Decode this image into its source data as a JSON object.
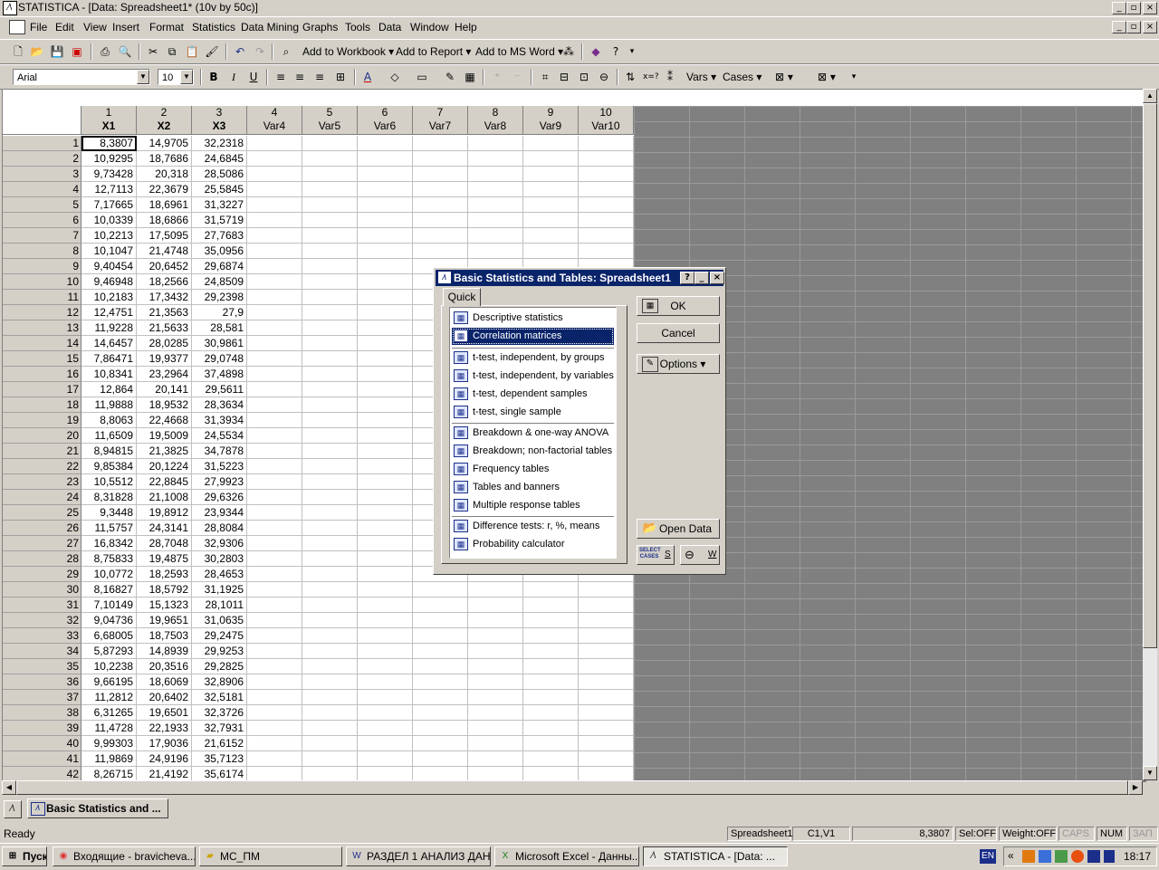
{
  "window": {
    "title": "STATISTICA - [Data: Spreadsheet1* (10v by 50c)]",
    "buttons": [
      "_",
      "▫",
      "×"
    ]
  },
  "menu": [
    "File",
    "Edit",
    "View",
    "Insert",
    "Format",
    "Statistics",
    "Data Mining",
    "Graphs",
    "Tools",
    "Data",
    "Window",
    "Help"
  ],
  "toolbar1": {
    "add_workbook": "Add to Workbook",
    "add_report": "Add to Report",
    "add_msword": "Add to MS Word"
  },
  "toolbar2": {
    "font": "Arial",
    "size": "10",
    "bold": "B",
    "italic": "I",
    "underline": "U",
    "vars": "Vars",
    "cases": "Cases"
  },
  "columns": [
    {
      "num": "1",
      "name": "X1"
    },
    {
      "num": "2",
      "name": "X2"
    },
    {
      "num": "3",
      "name": "X3"
    },
    {
      "num": "4",
      "name": "Var4"
    },
    {
      "num": "5",
      "name": "Var5"
    },
    {
      "num": "6",
      "name": "Var6"
    },
    {
      "num": "7",
      "name": "Var7"
    },
    {
      "num": "8",
      "name": "Var8"
    },
    {
      "num": "9",
      "name": "Var9"
    },
    {
      "num": "10",
      "name": "Var10"
    }
  ],
  "rows": [
    [
      "8,3807",
      "14,9705",
      "32,2318"
    ],
    [
      "10,9295",
      "18,7686",
      "24,6845"
    ],
    [
      "9,73428",
      "20,318",
      "28,5086"
    ],
    [
      "12,7113",
      "22,3679",
      "25,5845"
    ],
    [
      "7,17665",
      "18,6961",
      "31,3227"
    ],
    [
      "10,0339",
      "18,6866",
      "31,5719"
    ],
    [
      "10,2213",
      "17,5095",
      "27,7683"
    ],
    [
      "10,1047",
      "21,4748",
      "35,0956"
    ],
    [
      "9,40454",
      "20,6452",
      "29,6874"
    ],
    [
      "9,46948",
      "18,2566",
      "24,8509"
    ],
    [
      "10,2183",
      "17,3432",
      "29,2398"
    ],
    [
      "12,4751",
      "21,3563",
      "27,9"
    ],
    [
      "11,9228",
      "21,5633",
      "28,581"
    ],
    [
      "14,6457",
      "28,0285",
      "30,9861"
    ],
    [
      "7,86471",
      "19,9377",
      "29,0748"
    ],
    [
      "10,8341",
      "23,2964",
      "37,4898"
    ],
    [
      "12,864",
      "20,141",
      "29,5611"
    ],
    [
      "11,9888",
      "18,9532",
      "28,3634"
    ],
    [
      "8,8063",
      "22,4668",
      "31,3934"
    ],
    [
      "11,6509",
      "19,5009",
      "24,5534"
    ],
    [
      "8,94815",
      "21,3825",
      "34,7878"
    ],
    [
      "9,85384",
      "20,1224",
      "31,5223"
    ],
    [
      "10,5512",
      "22,8845",
      "27,9923"
    ],
    [
      "8,31828",
      "21,1008",
      "29,6326"
    ],
    [
      "9,3448",
      "19,8912",
      "23,9344"
    ],
    [
      "11,5757",
      "24,3141",
      "28,8084"
    ],
    [
      "16,8342",
      "28,7048",
      "32,9306"
    ],
    [
      "8,75833",
      "19,4875",
      "30,2803"
    ],
    [
      "10,0772",
      "18,2593",
      "28,4653"
    ],
    [
      "8,16827",
      "18,5792",
      "31,1925"
    ],
    [
      "7,10149",
      "15,1323",
      "28,1011"
    ],
    [
      "9,04736",
      "19,9651",
      "31,0635"
    ],
    [
      "6,68005",
      "18,7503",
      "29,2475"
    ],
    [
      "5,87293",
      "14,8939",
      "29,9253"
    ],
    [
      "10,2238",
      "20,3516",
      "29,2825"
    ],
    [
      "9,66195",
      "18,6069",
      "32,8906"
    ],
    [
      "11,2812",
      "20,6402",
      "32,5181"
    ],
    [
      "6,31265",
      "19,6501",
      "32,3726"
    ],
    [
      "11,4728",
      "22,1933",
      "32,7931"
    ],
    [
      "9,99303",
      "17,9036",
      "21,6152"
    ],
    [
      "11,9869",
      "24,9196",
      "35,7123"
    ],
    [
      "8,26715",
      "21,4192",
      "35,6174"
    ]
  ],
  "dialog": {
    "title": "Basic Statistics and Tables: Spreadsheet1",
    "tab": "Quick",
    "items": [
      {
        "label": "Descriptive statistics",
        "icon": "descriptive-icon"
      },
      {
        "label": "Correlation matrices",
        "icon": "correlation-icon",
        "selected": true
      },
      {
        "label": "t-test, independent, by groups",
        "icon": "ttest-groups-icon"
      },
      {
        "label": "t-test, independent, by variables",
        "icon": "ttest-vars-icon"
      },
      {
        "label": "t-test, dependent samples",
        "icon": "ttest-dependent-icon"
      },
      {
        "label": "t-test, single sample",
        "icon": "ttest-single-icon"
      },
      {
        "label": "Breakdown & one-way ANOVA",
        "icon": "breakdown-icon"
      },
      {
        "label": "Breakdown; non-factorial tables",
        "icon": "breakdown-nonfactorial-icon"
      },
      {
        "label": "Frequency tables",
        "icon": "frequency-icon"
      },
      {
        "label": "Tables and banners",
        "icon": "tables-icon"
      },
      {
        "label": "Multiple response tables",
        "icon": "multiresponse-icon"
      },
      {
        "label": "Difference tests: r, %, means",
        "icon": "difference-icon"
      },
      {
        "label": "Probability calculator",
        "icon": "probability-icon"
      }
    ],
    "ok": "OK",
    "cancel": "Cancel",
    "options": "Options",
    "open_data": "Open Data",
    "select_cases": "SELECT CASES",
    "s": "S",
    "w": "W"
  },
  "mdi_tab": "Basic Statistics and ...",
  "status": {
    "ready": "Ready",
    "sheet": "Spreadsheet1",
    "cell": "C1,V1",
    "value": "8,3807",
    "sel": "Sel:OFF",
    "weight": "Weight:OFF",
    "caps": "CAPS",
    "num": "NUM",
    "ins": "ЗАП"
  },
  "taskbar": {
    "start": "Пуск",
    "tasks": [
      "Входящие - bravicheva...",
      "МС_ПМ",
      "РАЗДЕЛ 1 АНАЛИЗ ДАН...",
      "Microsoft Excel - Данны...",
      "STATISTICA - [Data: ..."
    ],
    "lang": "EN",
    "time": "18:17"
  }
}
